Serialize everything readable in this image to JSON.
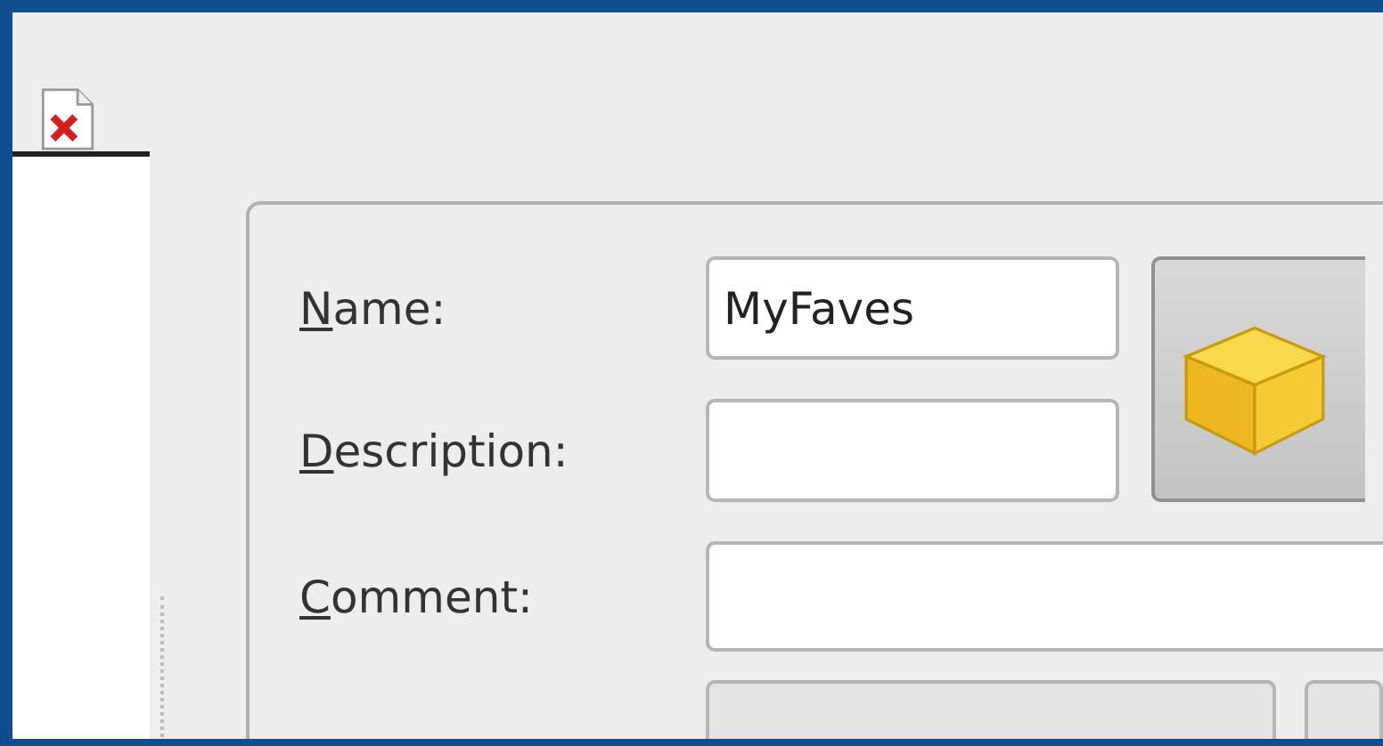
{
  "form": {
    "fields": [
      {
        "key": "N",
        "rest": "ame:",
        "value": "MyFaves"
      },
      {
        "key": "D",
        "rest": "escription:"
      },
      {
        "key": "C",
        "rest": "omment:"
      }
    ]
  }
}
